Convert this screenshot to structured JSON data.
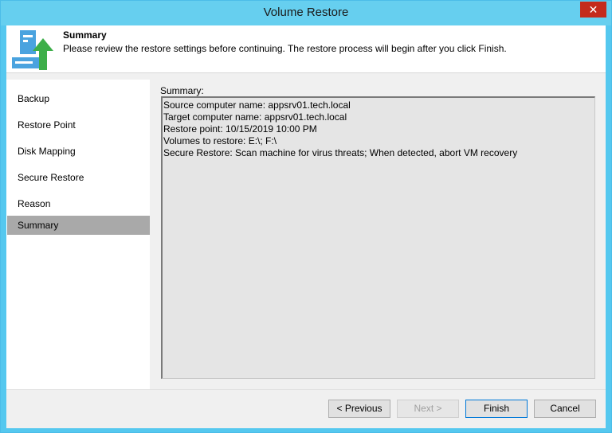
{
  "window": {
    "title": "Volume Restore",
    "close_glyph": "✕"
  },
  "header": {
    "title": "Summary",
    "description": "Please review the restore settings before continuing. The restore process will begin after you click Finish.",
    "icon": "server-restore-icon"
  },
  "sidebar": {
    "items": [
      {
        "label": "Backup"
      },
      {
        "label": "Restore Point"
      },
      {
        "label": "Disk Mapping"
      },
      {
        "label": "Secure Restore"
      },
      {
        "label": "Reason"
      },
      {
        "label": "Summary",
        "active": true
      }
    ]
  },
  "main": {
    "summary_label": "Summary:",
    "summary_lines": [
      "Source computer name: appsrv01.tech.local",
      "Target computer name: appsrv01.tech.local",
      "Restore point: 10/15/2019 10:00 PM",
      "Volumes to restore: E:\\; F:\\",
      "Secure Restore: Scan machine for virus threats; When detected, abort VM recovery"
    ]
  },
  "buttons": {
    "previous": "< Previous",
    "next": "Next >",
    "finish": "Finish",
    "cancel": "Cancel"
  },
  "colors": {
    "title_bar": "#66cfef",
    "close_button": "#c42b1c",
    "active_nav": "#a9a9a9",
    "icon_arrow": "#3dae49",
    "icon_server": "#4aa3df"
  }
}
